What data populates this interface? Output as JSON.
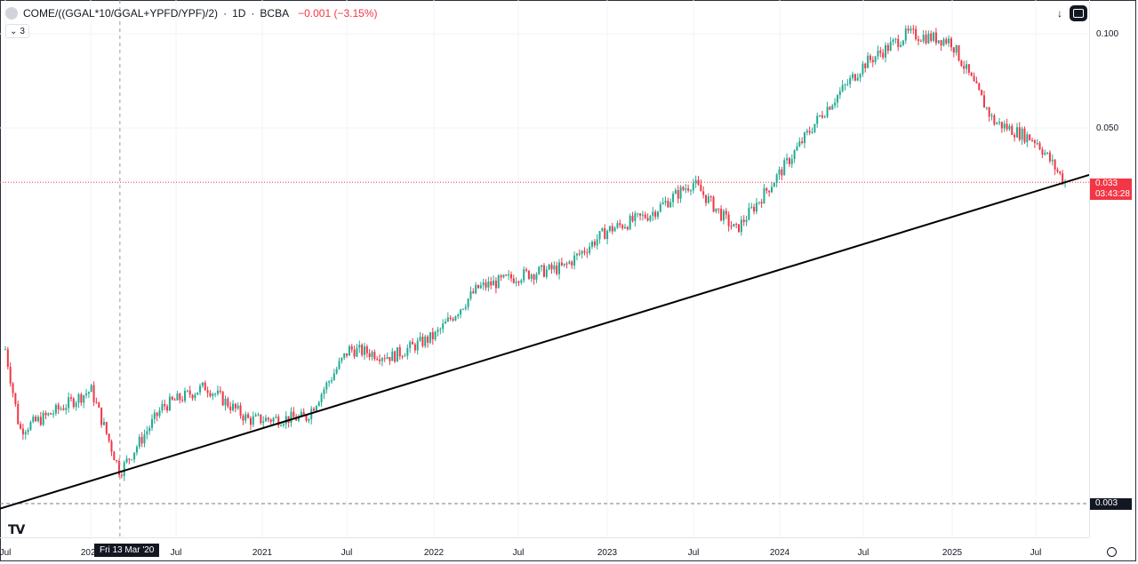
{
  "legend": {
    "symbol": "COME/((GGAL*10/GGAL+YPFD/YPF)/2)",
    "interval": "1D",
    "exchange": "BCBA",
    "separator": "·",
    "change": "−0.001 (−3.15%)"
  },
  "collapse_count": "3",
  "top_controls": {
    "arrow_icon": "arrow-down-icon",
    "fullscreen_icon": "fullscreen-icon"
  },
  "price_axis": {
    "ticks": [
      "0.100",
      "0.050"
    ]
  },
  "last_price": {
    "value": "0.033",
    "countdown": "03:43:28",
    "color": "#f23645"
  },
  "hline_price": {
    "value": "0.003",
    "color": "#131722"
  },
  "time_axis": {
    "labels": [
      "Jul",
      "2020",
      "Jul",
      "2021",
      "Jul",
      "2022",
      "Jul",
      "2023",
      "Jul",
      "2024",
      "Jul",
      "2025",
      "Jul"
    ],
    "crosshair_date": "Fri 13 Mar '20"
  },
  "colors": {
    "up": "#22ab94",
    "down": "#f23645",
    "trendline": "#000000",
    "grid": "#f0f3fa"
  },
  "chart_data": {
    "type": "candlestick",
    "title": "COME/((GGAL*10/GGAL+YPFD/YPF)/2) · 1D · BCBA",
    "y_scale": "log",
    "ylim": [
      0.003,
      0.13
    ],
    "x_range": [
      "2019-07",
      "2025-10"
    ],
    "series": [
      {
        "values_approx": [
          {
            "x": "2019-07",
            "y": 0.0095
          },
          {
            "x": "2019-08",
            "y": 0.0052
          },
          {
            "x": "2019-10",
            "y": 0.0058
          },
          {
            "x": "2020-01",
            "y": 0.007
          },
          {
            "x": "2020-03",
            "y": 0.0038
          },
          {
            "x": "2020-06",
            "y": 0.0062
          },
          {
            "x": "2020-09",
            "y": 0.0072
          },
          {
            "x": "2020-12",
            "y": 0.0056
          },
          {
            "x": "2021-04",
            "y": 0.0057
          },
          {
            "x": "2021-07",
            "y": 0.0095
          },
          {
            "x": "2021-10",
            "y": 0.009
          },
          {
            "x": "2022-01",
            "y": 0.0105
          },
          {
            "x": "2022-04",
            "y": 0.015
          },
          {
            "x": "2022-07",
            "y": 0.0165
          },
          {
            "x": "2022-10",
            "y": 0.0175
          },
          {
            "x": "2023-01",
            "y": 0.023
          },
          {
            "x": "2023-04",
            "y": 0.026
          },
          {
            "x": "2023-07",
            "y": 0.033
          },
          {
            "x": "2023-10",
            "y": 0.023
          },
          {
            "x": "2024-01",
            "y": 0.035
          },
          {
            "x": "2024-04",
            "y": 0.055
          },
          {
            "x": "2024-07",
            "y": 0.08
          },
          {
            "x": "2024-10",
            "y": 0.1
          },
          {
            "x": "2025-01",
            "y": 0.095
          },
          {
            "x": "2025-04",
            "y": 0.052
          },
          {
            "x": "2025-07",
            "y": 0.045
          },
          {
            "x": "2025-09",
            "y": 0.033
          }
        ]
      }
    ],
    "last_value": 0.033,
    "horizontal_line": 0.003,
    "trendline": [
      {
        "x": "2020-03",
        "y": 0.0038
      },
      {
        "x": "2025-09",
        "y": 0.033
      }
    ],
    "grid": true
  }
}
